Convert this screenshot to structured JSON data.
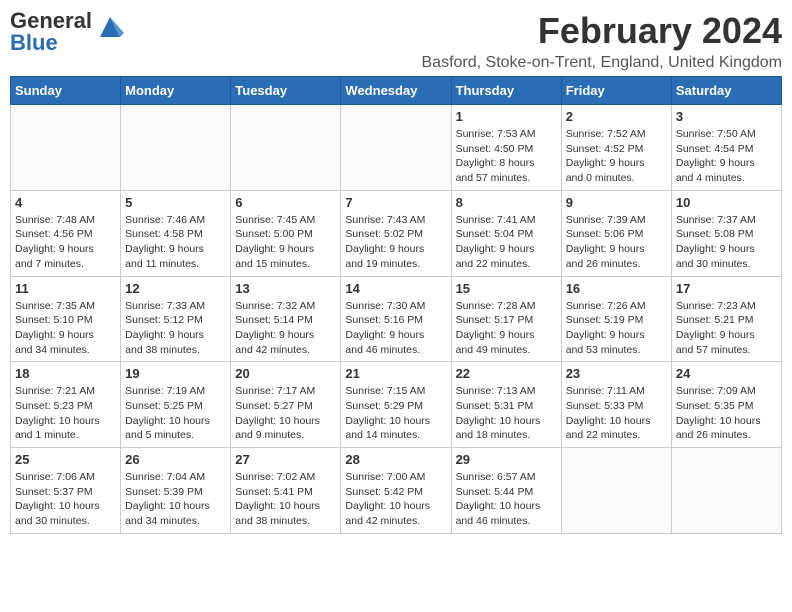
{
  "logo": {
    "general": "General",
    "blue": "Blue"
  },
  "title": "February 2024",
  "subtitle": "Basford, Stoke-on-Trent, England, United Kingdom",
  "days_header": [
    "Sunday",
    "Monday",
    "Tuesday",
    "Wednesday",
    "Thursday",
    "Friday",
    "Saturday"
  ],
  "weeks": [
    [
      {
        "day": "",
        "detail": ""
      },
      {
        "day": "",
        "detail": ""
      },
      {
        "day": "",
        "detail": ""
      },
      {
        "day": "",
        "detail": ""
      },
      {
        "day": "1",
        "detail": "Sunrise: 7:53 AM\nSunset: 4:50 PM\nDaylight: 8 hours\nand 57 minutes."
      },
      {
        "day": "2",
        "detail": "Sunrise: 7:52 AM\nSunset: 4:52 PM\nDaylight: 9 hours\nand 0 minutes."
      },
      {
        "day": "3",
        "detail": "Sunrise: 7:50 AM\nSunset: 4:54 PM\nDaylight: 9 hours\nand 4 minutes."
      }
    ],
    [
      {
        "day": "4",
        "detail": "Sunrise: 7:48 AM\nSunset: 4:56 PM\nDaylight: 9 hours\nand 7 minutes."
      },
      {
        "day": "5",
        "detail": "Sunrise: 7:46 AM\nSunset: 4:58 PM\nDaylight: 9 hours\nand 11 minutes."
      },
      {
        "day": "6",
        "detail": "Sunrise: 7:45 AM\nSunset: 5:00 PM\nDaylight: 9 hours\nand 15 minutes."
      },
      {
        "day": "7",
        "detail": "Sunrise: 7:43 AM\nSunset: 5:02 PM\nDaylight: 9 hours\nand 19 minutes."
      },
      {
        "day": "8",
        "detail": "Sunrise: 7:41 AM\nSunset: 5:04 PM\nDaylight: 9 hours\nand 22 minutes."
      },
      {
        "day": "9",
        "detail": "Sunrise: 7:39 AM\nSunset: 5:06 PM\nDaylight: 9 hours\nand 26 minutes."
      },
      {
        "day": "10",
        "detail": "Sunrise: 7:37 AM\nSunset: 5:08 PM\nDaylight: 9 hours\nand 30 minutes."
      }
    ],
    [
      {
        "day": "11",
        "detail": "Sunrise: 7:35 AM\nSunset: 5:10 PM\nDaylight: 9 hours\nand 34 minutes."
      },
      {
        "day": "12",
        "detail": "Sunrise: 7:33 AM\nSunset: 5:12 PM\nDaylight: 9 hours\nand 38 minutes."
      },
      {
        "day": "13",
        "detail": "Sunrise: 7:32 AM\nSunset: 5:14 PM\nDaylight: 9 hours\nand 42 minutes."
      },
      {
        "day": "14",
        "detail": "Sunrise: 7:30 AM\nSunset: 5:16 PM\nDaylight: 9 hours\nand 46 minutes."
      },
      {
        "day": "15",
        "detail": "Sunrise: 7:28 AM\nSunset: 5:17 PM\nDaylight: 9 hours\nand 49 minutes."
      },
      {
        "day": "16",
        "detail": "Sunrise: 7:26 AM\nSunset: 5:19 PM\nDaylight: 9 hours\nand 53 minutes."
      },
      {
        "day": "17",
        "detail": "Sunrise: 7:23 AM\nSunset: 5:21 PM\nDaylight: 9 hours\nand 57 minutes."
      }
    ],
    [
      {
        "day": "18",
        "detail": "Sunrise: 7:21 AM\nSunset: 5:23 PM\nDaylight: 10 hours\nand 1 minute."
      },
      {
        "day": "19",
        "detail": "Sunrise: 7:19 AM\nSunset: 5:25 PM\nDaylight: 10 hours\nand 5 minutes."
      },
      {
        "day": "20",
        "detail": "Sunrise: 7:17 AM\nSunset: 5:27 PM\nDaylight: 10 hours\nand 9 minutes."
      },
      {
        "day": "21",
        "detail": "Sunrise: 7:15 AM\nSunset: 5:29 PM\nDaylight: 10 hours\nand 14 minutes."
      },
      {
        "day": "22",
        "detail": "Sunrise: 7:13 AM\nSunset: 5:31 PM\nDaylight: 10 hours\nand 18 minutes."
      },
      {
        "day": "23",
        "detail": "Sunrise: 7:11 AM\nSunset: 5:33 PM\nDaylight: 10 hours\nand 22 minutes."
      },
      {
        "day": "24",
        "detail": "Sunrise: 7:09 AM\nSunset: 5:35 PM\nDaylight: 10 hours\nand 26 minutes."
      }
    ],
    [
      {
        "day": "25",
        "detail": "Sunrise: 7:06 AM\nSunset: 5:37 PM\nDaylight: 10 hours\nand 30 minutes."
      },
      {
        "day": "26",
        "detail": "Sunrise: 7:04 AM\nSunset: 5:39 PM\nDaylight: 10 hours\nand 34 minutes."
      },
      {
        "day": "27",
        "detail": "Sunrise: 7:02 AM\nSunset: 5:41 PM\nDaylight: 10 hours\nand 38 minutes."
      },
      {
        "day": "28",
        "detail": "Sunrise: 7:00 AM\nSunset: 5:42 PM\nDaylight: 10 hours\nand 42 minutes."
      },
      {
        "day": "29",
        "detail": "Sunrise: 6:57 AM\nSunset: 5:44 PM\nDaylight: 10 hours\nand 46 minutes."
      },
      {
        "day": "",
        "detail": ""
      },
      {
        "day": "",
        "detail": ""
      }
    ]
  ]
}
